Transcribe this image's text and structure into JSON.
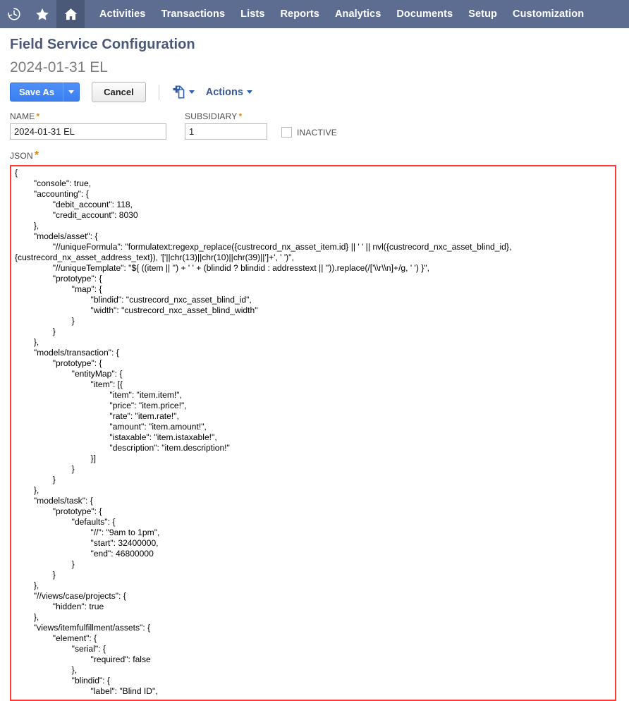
{
  "navbar": {
    "icons": [
      {
        "name": "recent-history-icon",
        "glyph": "history"
      },
      {
        "name": "favorites-star-icon",
        "glyph": "star"
      },
      {
        "name": "home-icon",
        "glyph": "home"
      }
    ],
    "links": [
      {
        "label": "Activities"
      },
      {
        "label": "Transactions"
      },
      {
        "label": "Lists"
      },
      {
        "label": "Reports"
      },
      {
        "label": "Analytics"
      },
      {
        "label": "Documents"
      },
      {
        "label": "Setup"
      },
      {
        "label": "Customization"
      }
    ],
    "background_color": "#5d6d91",
    "active_background_color": "#4a5978"
  },
  "header": {
    "page_title": "Field Service Configuration",
    "record_title": "2024-01-31 EL"
  },
  "toolbar": {
    "save_as_label": "Save As",
    "save_as_caret": "▾",
    "cancel_label": "Cancel",
    "new_document_icon": "new-document-icon",
    "actions_label": "Actions",
    "actions_caret": "▾",
    "primary_color": "#4287f5"
  },
  "form": {
    "required_marker": "*",
    "name": {
      "label": "NAME",
      "value": "2024-01-31 EL",
      "placeholder": ""
    },
    "subsidiary": {
      "label": "SUBSIDIARY",
      "value": "1",
      "placeholder": ""
    },
    "inactive": {
      "label": "INACTIVE",
      "checked": false
    },
    "json": {
      "label": "JSON",
      "border_color": "#ff3a36",
      "value": "{\n        \"console\": true,\n        \"accounting\": {\n                \"debit_account\": 118,\n                \"credit_account\": 8030\n        },\n        \"models/asset\": {\n                \"//uniqueFormula\": \"formulatext:regexp_replace({custrecord_nx_asset_item.id} || ' ' || nvl({custrecord_nxc_asset_blind_id}, {custrecord_nx_asset_address_text}), '['||chr(13)||chr(10)||chr(39)||']+', ' ')\",\n                \"//uniqueTemplate\": \"${ ((item || '') + ' ' + (blindid ? blindid : addresstext || '')).replace(/['\\\\r\\\\n]+/g, ' ') }\",\n                \"prototype\": {\n                        \"map\": {\n                                \"blindid\": \"custrecord_nxc_asset_blind_id\",\n                                \"width\": \"custrecord_nxc_asset_blind_width\"\n                        }\n                }\n        },\n        \"models/transaction\": {\n                \"prototype\": {\n                        \"entityMap\": {\n                                \"item\": [{\n                                        \"item\": \"item.item!\",\n                                        \"price\": \"item.price!\",\n                                        \"rate\": \"item.rate!\",\n                                        \"amount\": \"item.amount!\",\n                                        \"istaxable\": \"item.istaxable!\",\n                                        \"description\": \"item.description!\"\n                                }]\n                        }\n                }\n        },\n        \"models/task\": {\n                \"prototype\": {\n                        \"defaults\": {\n                                \"//\": \"9am to 1pm\",\n                                \"start\": 32400000,\n                                \"end\": 46800000\n                        }\n                }\n        },\n        \"//views/case/projects\": {\n                \"hidden\": true\n        },\n        \"views/itemfulfillment/assets\": {\n                \"element\": {\n                        \"serial\": {\n                                \"required\": false\n                        },\n                        \"blindid\": {\n                                \"label\": \"Blind ID\",\n"
    }
  }
}
